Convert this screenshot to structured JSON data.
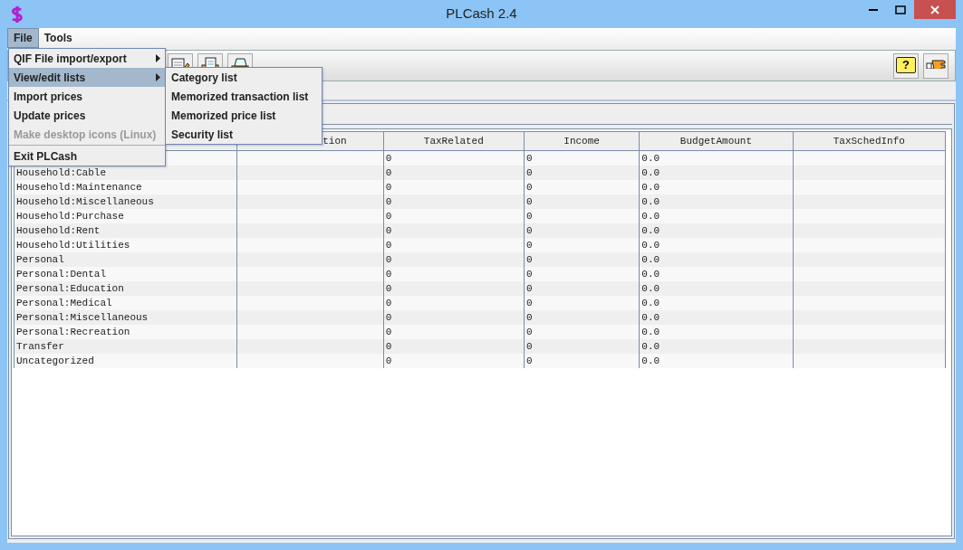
{
  "window": {
    "title": "PLCash 2.4"
  },
  "menubar": [
    {
      "label": "File",
      "selected": true
    },
    {
      "label": "Tools",
      "selected": false
    }
  ],
  "file_menu": [
    {
      "kind": "submenu",
      "label": "QIF File import/export",
      "selected": false,
      "disabled": false
    },
    {
      "kind": "submenu",
      "label": "View/edit lists",
      "selected": true,
      "disabled": false
    },
    {
      "kind": "item",
      "label": "Import prices",
      "selected": false,
      "disabled": false
    },
    {
      "kind": "item",
      "label": "Update prices",
      "selected": false,
      "disabled": false
    },
    {
      "kind": "item",
      "label": "Make desktop icons (Linux)",
      "selected": false,
      "disabled": true
    },
    {
      "kind": "separator"
    },
    {
      "kind": "item",
      "label": "Exit PLCash",
      "selected": false,
      "disabled": false
    }
  ],
  "submenu": [
    {
      "label": "Category list"
    },
    {
      "label": "Memorized transaction list"
    },
    {
      "label": "Memorized price list"
    },
    {
      "label": "Security list"
    }
  ],
  "toolbar": {
    "left": [
      {
        "kind": "edit"
      },
      {
        "kind": "save"
      },
      {
        "kind": "print"
      }
    ],
    "right": [
      {
        "kind": "help",
        "label": "?"
      },
      {
        "kind": "hand"
      }
    ]
  },
  "table": {
    "columns": [
      {},
      {
        "label": "tion"
      },
      {
        "label": "TaxRelated"
      },
      {
        "label": "Income"
      },
      {
        "label": "BudgetAmount"
      },
      {
        "label": "TaxSchedInfo"
      }
    ],
    "rows": [
      [
        "",
        "",
        "0",
        "0",
        "0.0",
        ""
      ],
      [
        "Household:Cable",
        "",
        "0",
        "0",
        "0.0",
        ""
      ],
      [
        "Household:Maintenance",
        "",
        "0",
        "0",
        "0.0",
        ""
      ],
      [
        "Household:Miscellaneous",
        "",
        "0",
        "0",
        "0.0",
        ""
      ],
      [
        "Household:Purchase",
        "",
        "0",
        "0",
        "0.0",
        ""
      ],
      [
        "Household:Rent",
        "",
        "0",
        "0",
        "0.0",
        ""
      ],
      [
        "Household:Utilities",
        "",
        "0",
        "0",
        "0.0",
        ""
      ],
      [
        "Personal",
        "",
        "0",
        "0",
        "0.0",
        ""
      ],
      [
        "Personal:Dental",
        "",
        "0",
        "0",
        "0.0",
        ""
      ],
      [
        "Personal:Education",
        "",
        "0",
        "0",
        "0.0",
        ""
      ],
      [
        "Personal:Medical",
        "",
        "0",
        "0",
        "0.0",
        ""
      ],
      [
        "Personal:Miscellaneous",
        "",
        "0",
        "0",
        "0.0",
        ""
      ],
      [
        "Personal:Recreation",
        "",
        "0",
        "0",
        "0.0",
        ""
      ],
      [
        "Transfer",
        "",
        "0",
        "0",
        "0.0",
        ""
      ],
      [
        "Uncategorized",
        "",
        "0",
        "0",
        "0.0",
        ""
      ]
    ]
  }
}
